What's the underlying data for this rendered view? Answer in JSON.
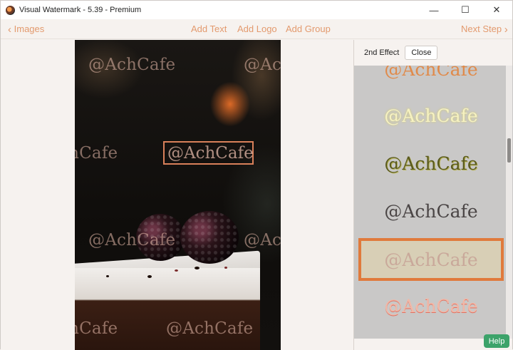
{
  "window": {
    "title": "Visual Watermark - 5.39 - Premium"
  },
  "title_buttons": {
    "minimize": "—",
    "maximize": "☐",
    "close": "✕"
  },
  "toolbar": {
    "back_label": "Images",
    "add_text": "Add Text",
    "add_logo": "Add Logo",
    "add_group": "Add Group",
    "next_label": "Next Step",
    "accent_color": "#e39a6e"
  },
  "canvas": {
    "watermark_text": "@AchCafe",
    "selected_watermark_text": "@AchCafe"
  },
  "effect_panel": {
    "label": "2nd Effect",
    "close_label": "Close",
    "effects": [
      {
        "text": "@AchCafe",
        "style": "orange-gradient"
      },
      {
        "text": "@AchCafe",
        "style": "yellow-glow"
      },
      {
        "text": "@AchCafe",
        "style": "olive-emboss"
      },
      {
        "text": "@AchCafe",
        "style": "dark-gray"
      },
      {
        "text": "@AchCafe",
        "style": "rose-on-beige",
        "selected": true
      },
      {
        "text": "@AchCafe",
        "style": "pink-gradient"
      }
    ],
    "selected_border_color": "#e07a3c"
  },
  "help": {
    "label": "Help",
    "color": "#3ca36a"
  }
}
